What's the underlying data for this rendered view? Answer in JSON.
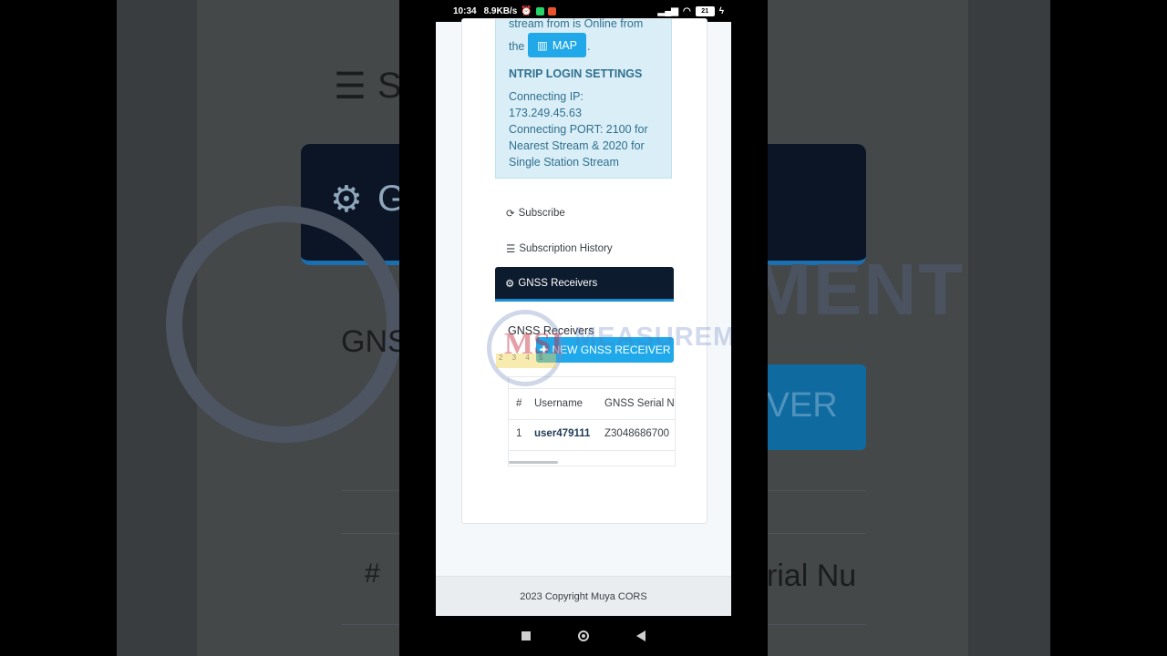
{
  "statusbar": {
    "time": "10:34",
    "speed": "8.9KB/s",
    "battery": "21"
  },
  "info": {
    "line1": "stream from is Online from",
    "line2_prefix": "the",
    "map_label": "MAP",
    "line2_suffix": ".",
    "heading": "NTRIP LOGIN SETTINGS",
    "ip_label": "Connecting IP:",
    "ip_value": "173.249.45.63",
    "port_line1": "Connecting PORT: 2100 for",
    "port_line2": "Nearest Stream & 2020 for",
    "port_line3": "Single Station Stream"
  },
  "nav": {
    "subscribe": "Subscribe",
    "history": "Subscription History",
    "receivers": "GNSS Receivers"
  },
  "section": {
    "title": "GNSS Receivers",
    "new_button": "NEW GNSS RECEIVER"
  },
  "table": {
    "headers": [
      "#",
      "Username",
      "GNSS Serial Nu"
    ],
    "rows": [
      [
        "1",
        "user479111",
        "Z3048686700"
      ]
    ]
  },
  "watermark": {
    "logo": "MSI",
    "text": "MEASUREMENT"
  },
  "footer": {
    "copyright": "2023 Copyright Muya CORS"
  },
  "background": {
    "title_fragment": "S",
    "card_fragment": "G",
    "gns_fragment": "GNS",
    "btn_fragment": "IVER",
    "wm_fragment": "EMENT",
    "table_hash": "#",
    "table_serial": "erial Nu"
  }
}
